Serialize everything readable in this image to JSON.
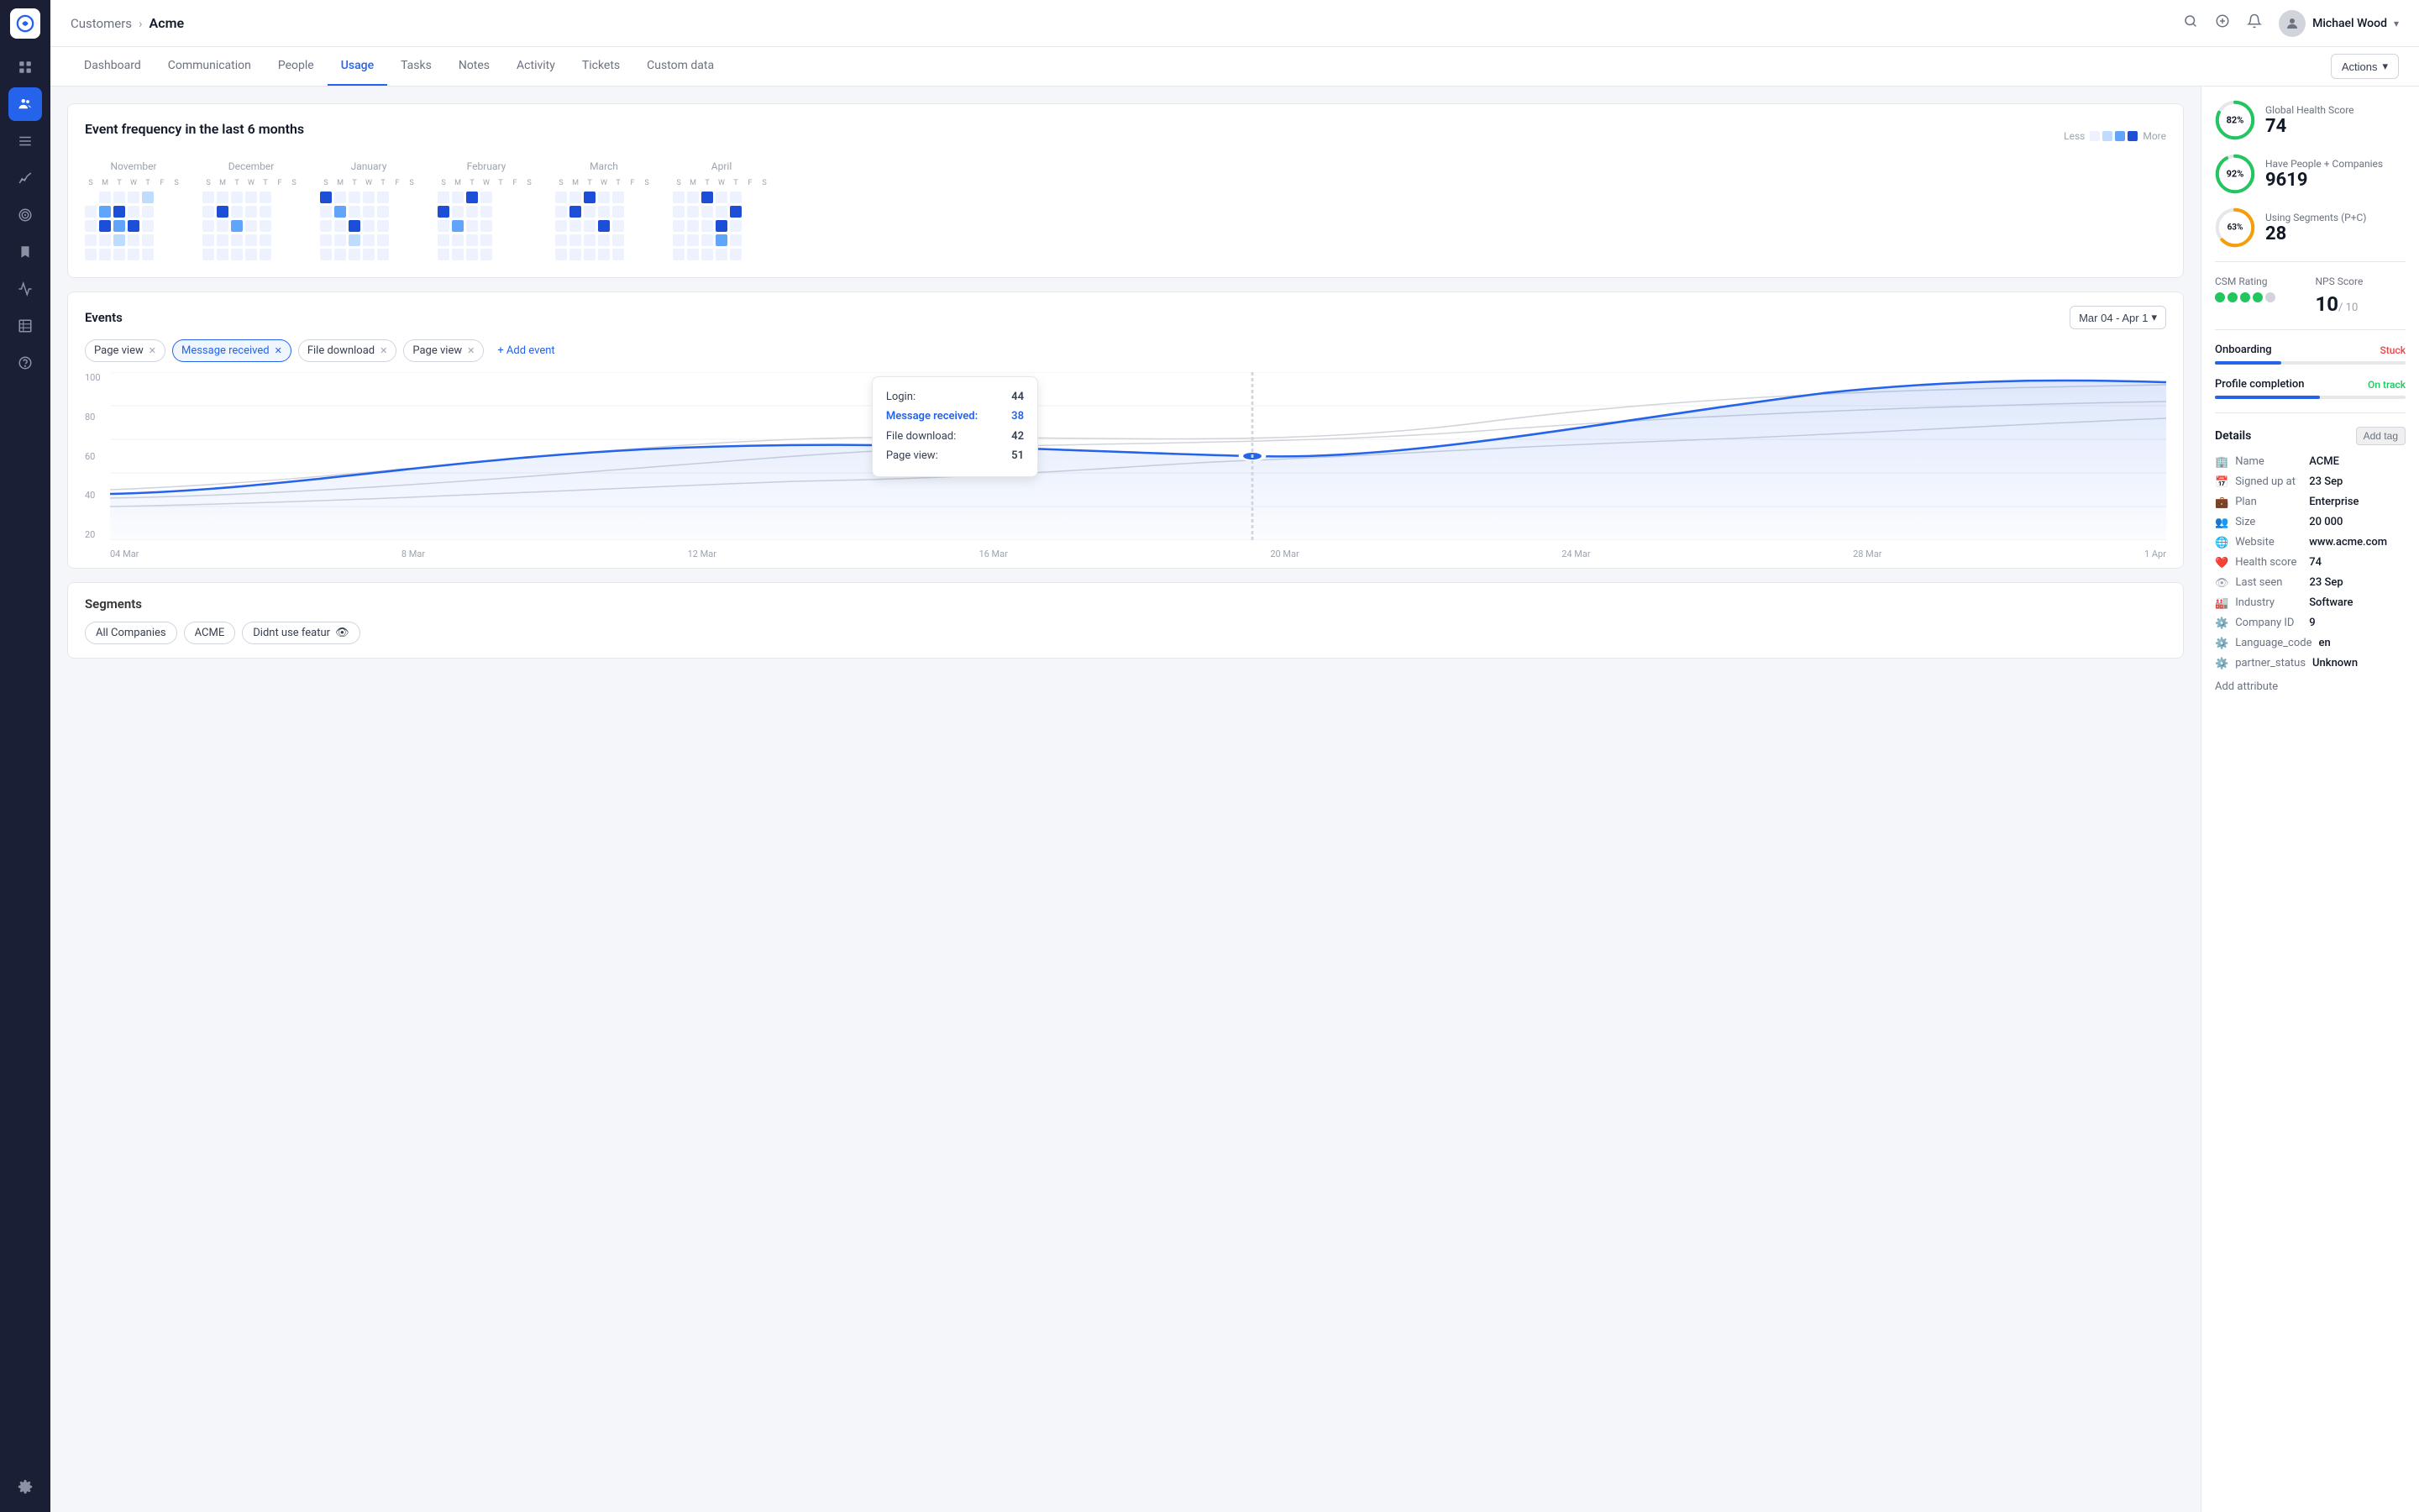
{
  "app": {
    "logo_alt": "App logo"
  },
  "header": {
    "breadcrumb_parent": "Customers",
    "breadcrumb_current": "Acme",
    "user_name": "Michael Wood"
  },
  "tabs": {
    "items": [
      {
        "label": "Dashboard",
        "id": "dashboard",
        "active": false
      },
      {
        "label": "Communication",
        "id": "communication",
        "active": false
      },
      {
        "label": "People",
        "id": "people",
        "active": false
      },
      {
        "label": "Usage",
        "id": "usage",
        "active": true
      },
      {
        "label": "Tasks",
        "id": "tasks",
        "active": false
      },
      {
        "label": "Notes",
        "id": "notes",
        "active": false
      },
      {
        "label": "Activity",
        "id": "activity",
        "active": false
      },
      {
        "label": "Tickets",
        "id": "tickets",
        "active": false
      },
      {
        "label": "Custom data",
        "id": "custom-data",
        "active": false
      }
    ],
    "actions_label": "Actions"
  },
  "heatmap": {
    "title": "Event frequency in the last 6 months",
    "legend_less": "Less",
    "legend_more": "More",
    "months": [
      "November",
      "December",
      "January",
      "February",
      "March",
      "April"
    ]
  },
  "events": {
    "title": "Events",
    "date_range": "Mar 04 - Apr 1",
    "filters": [
      {
        "label": "Page view",
        "active": false
      },
      {
        "label": "Message received",
        "active": true
      },
      {
        "label": "File download",
        "active": false
      },
      {
        "label": "Page view",
        "active": false
      }
    ],
    "add_event_label": "+ Add event",
    "y_labels": [
      "100",
      "80",
      "60",
      "40",
      "20"
    ],
    "x_labels": [
      "04 Mar",
      "8 Mar",
      "12 Mar",
      "16 Mar",
      "20 Mar",
      "24 Mar",
      "28 Mar",
      "1 Apr"
    ],
    "tooltip": {
      "login_label": "Login:",
      "login_val": "44",
      "message_label": "Message received:",
      "message_val": "38",
      "file_label": "File download:",
      "file_val": "42",
      "page_label": "Page view:",
      "page_val": "51"
    }
  },
  "segments": {
    "title": "Segments",
    "items": [
      {
        "label": "All Companies"
      },
      {
        "label": "ACME"
      },
      {
        "label": "Didnt use featur",
        "has_eye": true
      }
    ]
  },
  "right_panel": {
    "global_health": {
      "name": "Global Health Score",
      "value": "74",
      "percent": 82,
      "color": "#22c55e"
    },
    "have_people": {
      "name": "Have People + Companies",
      "value": "9619",
      "percent": 92,
      "color": "#22c55e"
    },
    "using_segments": {
      "name": "Using Segments (P+C)",
      "value": "28",
      "percent": 63,
      "color": "#f59e0b"
    },
    "csm_rating": {
      "label": "CSM Rating",
      "dots": [
        true,
        true,
        true,
        true,
        false
      ]
    },
    "nps_score": {
      "label": "NPS Score",
      "value": "10",
      "max": "/ 10"
    },
    "onboarding": {
      "label": "Onboarding",
      "status": "Stuck",
      "progress": 35
    },
    "profile_completion": {
      "label": "Profile completion",
      "status": "On track",
      "progress": 55
    },
    "details": {
      "title": "Details",
      "add_tag": "Add tag",
      "items": [
        {
          "icon": "🏢",
          "key": "Name",
          "val": "ACME"
        },
        {
          "icon": "📅",
          "key": "Signed up at",
          "val": "23 Sep"
        },
        {
          "icon": "💼",
          "key": "Plan",
          "val": "Enterprise"
        },
        {
          "icon": "👥",
          "key": "Size",
          "val": "20 000"
        },
        {
          "icon": "🌐",
          "key": "Website",
          "val": "www.acme.com"
        },
        {
          "icon": "❤️",
          "key": "Health score",
          "val": "74"
        },
        {
          "icon": "👁",
          "key": "Last seen",
          "val": "23 Sep"
        },
        {
          "icon": "🏭",
          "key": "Industry",
          "val": "Software"
        },
        {
          "icon": "⚙️",
          "key": "Company ID",
          "val": "9"
        },
        {
          "icon": "⚙️",
          "key": "Language_code",
          "val": "en"
        },
        {
          "icon": "⚙️",
          "key": "partner_status",
          "val": "Unknown"
        }
      ],
      "add_attribute": "Add attribute"
    }
  }
}
